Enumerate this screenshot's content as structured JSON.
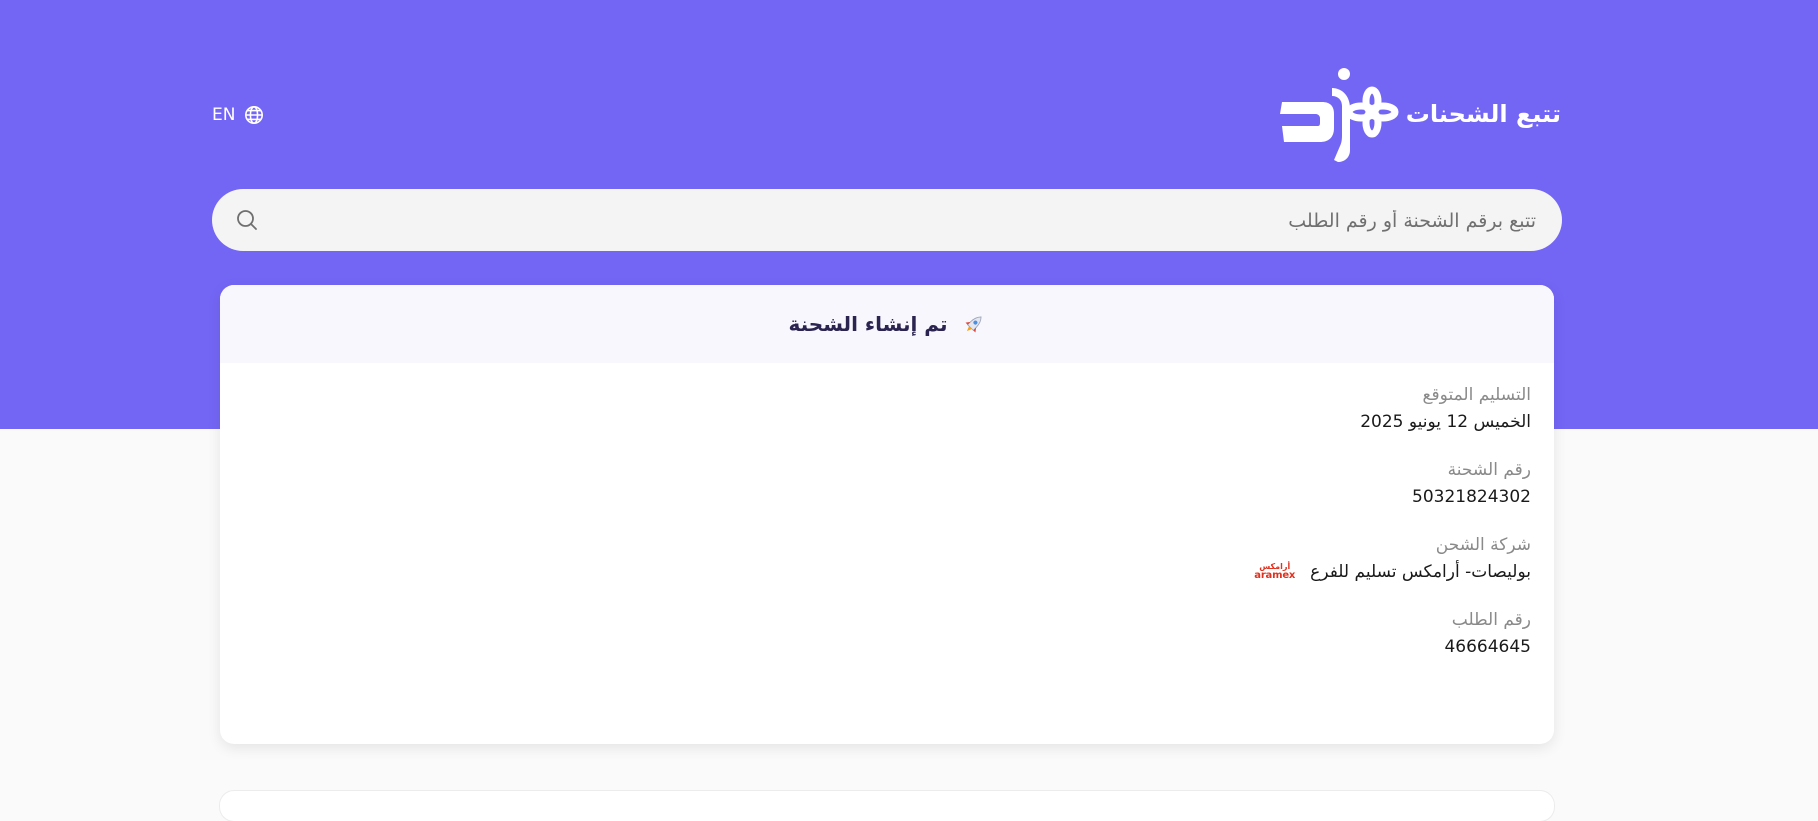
{
  "header": {
    "brand_text": "تتبع الشحنات",
    "logo_icon": "zid-logo",
    "language_label": "EN",
    "language_icon": "globe-icon"
  },
  "search": {
    "placeholder": "تتبع برقم الشحنة أو رقم الطلب",
    "value": "",
    "icon": "search-icon"
  },
  "shipment": {
    "status_title": "تم إنشاء الشحنة",
    "status_icon": "rocket-icon",
    "fields": {
      "expected_delivery": {
        "label": "التسليم المتوقع",
        "value": "الخميس 12 يونيو 2025"
      },
      "shipment_number": {
        "label": "رقم الشحنة",
        "value": "50321824302"
      },
      "carrier": {
        "label": "شركة الشحن",
        "value": "بوليصات- أرامكس تسليم للفرع",
        "logo_ar": "أرامكس",
        "logo_en": "aramex"
      },
      "order_number": {
        "label": "رقم الطلب",
        "value": "46664645"
      }
    }
  },
  "colors": {
    "hero_background": "#7466f5",
    "page_background": "#fafafa",
    "card_header_background": "#f8f7fd",
    "status_title": "#2b2450",
    "aramex_red": "#e0301e"
  }
}
